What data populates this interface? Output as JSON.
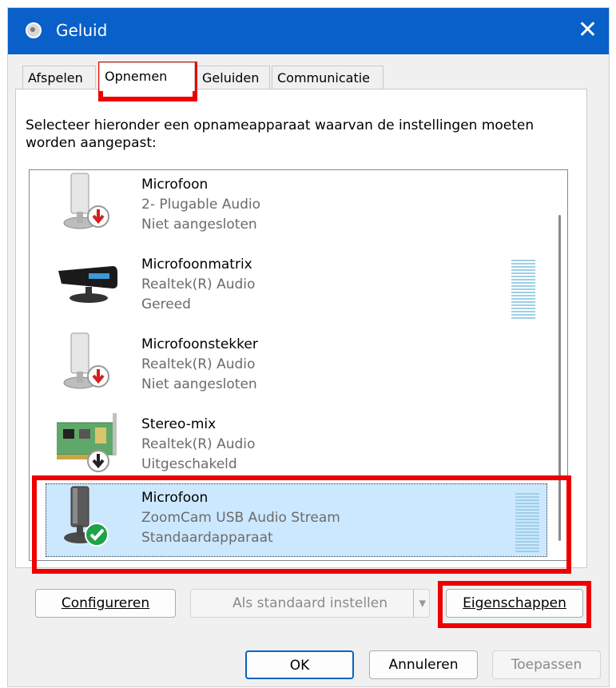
{
  "window": {
    "title": "Geluid"
  },
  "tabs": [
    {
      "label": "Afspelen"
    },
    {
      "label": "Opnemen"
    },
    {
      "label": "Geluiden"
    },
    {
      "label": "Communicatie"
    }
  ],
  "instruction": "Selecteer hieronder een opnameapparaat waarvan de instellingen moeten worden aangepast:",
  "devices": [
    {
      "name": "Microfoon",
      "driver": "2- Plugable Audio",
      "status": "Niet aangesloten",
      "icon": "microphone-disconnected-icon"
    },
    {
      "name": "Microfoonmatrix",
      "driver": "Realtek(R) Audio",
      "status": "Gereed",
      "icon": "microphone-array-icon"
    },
    {
      "name": "Microfoonstekker",
      "driver": "Realtek(R) Audio",
      "status": "Niet aangesloten",
      "icon": "microphone-disconnected-icon"
    },
    {
      "name": "Stereo-mix",
      "driver": "Realtek(R) Audio",
      "status": "Uitgeschakeld",
      "icon": "sound-card-disabled-icon"
    },
    {
      "name": "Microfoon",
      "driver": "ZoomCam USB Audio Stream",
      "status": "Standaardapparaat",
      "icon": "microphone-default-icon"
    }
  ],
  "buttons": {
    "configure": "Configureren",
    "set_default": "Als standaard instellen",
    "properties": "Eigenschappen",
    "ok": "OK",
    "cancel": "Annuleren",
    "apply": "Toepassen"
  },
  "colors": {
    "titlebar": "#0860c8",
    "selection": "#cce8ff",
    "highlight": "#ee0000"
  }
}
